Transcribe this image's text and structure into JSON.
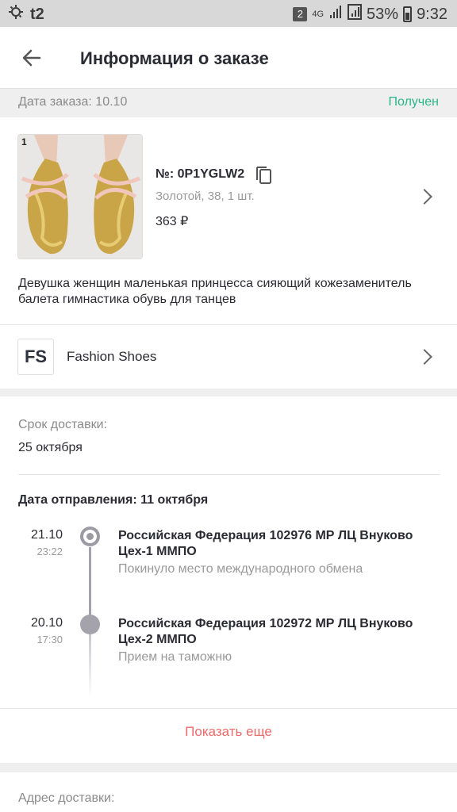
{
  "status_bar": {
    "carrier": "t2",
    "sim_badge": "2",
    "network": "4G",
    "battery": "53%",
    "time": "9:32"
  },
  "header": {
    "title": "Информация о заказе"
  },
  "order": {
    "date_label": "Дата заказа: 10.10",
    "status": "Получен",
    "status_color": "#2bb68a"
  },
  "product": {
    "quantity_badge": "1",
    "order_number": "№: 0P1YGLW2",
    "variant": "Золотой, 38, 1 шт.",
    "price": "363 ₽",
    "description": "Девушка женщин маленькая принцесса сияющий кожезаменитель балета гимнастика обувь для танцев"
  },
  "store": {
    "logo": "FS",
    "name": "Fashion Shoes"
  },
  "delivery": {
    "term_label": "Срок доставки:",
    "term_value": "25 октября",
    "ship_date": "Дата отправления: 11 октября",
    "events": [
      {
        "date": "21.10",
        "time": "23:22",
        "title": "Российская Федерация 102976 МР ЛЦ Внуково Цех-1 ММПО",
        "subtitle": "Покинуло место международного обмена"
      },
      {
        "date": "20.10",
        "time": "17:30",
        "title": "Российская Федерация 102972 МР ЛЦ Внуково Цех-2 ММПО",
        "subtitle": "Прием на таможню"
      }
    ],
    "show_more": "Показать еще",
    "accent_color": "#ec6b6b"
  },
  "address": {
    "label": "Адрес доставки:"
  }
}
